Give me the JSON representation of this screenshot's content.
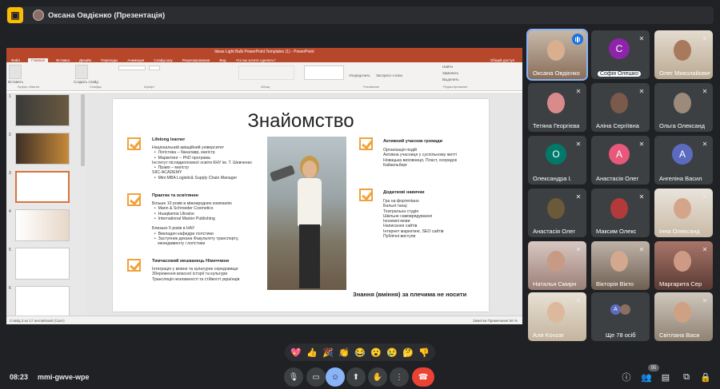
{
  "presenter": {
    "name": "Оксана Овдієнко (Презентація)"
  },
  "ppt": {
    "window_title": "Ideas Light Bulb PowerPoint Templates (1) - PowerPoint",
    "tabs": [
      "Файл",
      "Главная",
      "Вставка",
      "Дизайн",
      "Переходы",
      "Анимация",
      "Слайд-шоу",
      "Рецензирование",
      "Вид",
      "Что вы хотите сделать?"
    ],
    "share": "Общий доступ",
    "ribbon_groups": [
      "Буфер обмена",
      "Слайды",
      "Шрифт",
      "Абзац",
      "Рисование",
      "Редактирование"
    ],
    "ribbon_buttons": {
      "paste": "Вставить",
      "new_slide": "Создать слайд",
      "arrange": "Упорядочить",
      "styles": "Экспресс-стили",
      "find": "Найти",
      "replace": "Заменить",
      "select": "Выделить"
    },
    "status_left": "Слайд 3 из 17     английский (США)",
    "status_right": "Заметки   Примечания        56 %"
  },
  "slide": {
    "title": "Знайомство",
    "sections": [
      {
        "heading": "Lifelong learner",
        "body": "Національний авіаційний університет\n  •  Логістика – бакалавр, магістр\n  •  Маркетинг – PhD програма\nІнститут післядипломної освіти КНУ ім. Т. Шевченко\n  •  Право – магістр\nSIIC-ACADEMY\n  •  Mini MBA Logistic& Supply Chain Manager"
      },
      {
        "heading": "Практик та освітянин",
        "body": "Більше 10 років в міжнародних компаніях\n  •  Mann & Schroeder Cosmetics\n  •  Huaqiiamia Ukraine\n  •  International Master Publishing\n\nБлизько 5 років в НАУ\n  •  Викладач кафедри логістики\n  •  Заступник декана Факультету транспорту,\n     менеджменту і логістики"
      },
      {
        "heading": "Тимчасовий мешканець Німеччини",
        "body": "Інтеграція у мовне та культурне середовище\nЗбереження власної історії та культури\nТрансляція незламності та стійкості українців"
      },
      {
        "heading": "Активний учасник громади",
        "body": "Організація подій\nАктивна учасниця у суспільному житті\nНовацька виховниця, Пласт, осередок\nКайзельберг"
      },
      {
        "heading": "Додаткові навички",
        "body": "Гра на фортепіано\nБальні танці\nТеатральна студія\nШкільне самоврядування\nІноземні мови\nНаписання сайтів\nІнтернет маркетинг, SEO сайтів\nПублічні виступи"
      }
    ],
    "tagline": "Знання (вміння) за плечима не носити"
  },
  "participants": [
    {
      "name": "Оксана Овдієнко",
      "type": "video",
      "speaking": true
    },
    {
      "name": "Софія Олешко",
      "type": "avatar",
      "letter": "С",
      "color": "#8e24aa"
    },
    {
      "name": "Олег Миколайович",
      "type": "video"
    },
    {
      "name": "Тетяна Георгієва",
      "type": "photo"
    },
    {
      "name": "Аліна Сергіївна",
      "type": "photo"
    },
    {
      "name": "Ольга Олександ",
      "type": "photo"
    },
    {
      "name": "Олександра І.",
      "type": "avatar",
      "letter": "О",
      "color": "#00796b"
    },
    {
      "name": "Анастасія Олег",
      "type": "avatar",
      "letter": "А",
      "color": "#e8587a"
    },
    {
      "name": "Ангеліна Васил",
      "type": "avatar",
      "letter": "А",
      "color": "#5c6bc0"
    },
    {
      "name": "Анастасія Олег",
      "type": "photo"
    },
    {
      "name": "Максим Олекс",
      "type": "photo"
    },
    {
      "name": "Інна Олександ",
      "type": "video"
    },
    {
      "name": "Наталья Смирн",
      "type": "video"
    },
    {
      "name": "Вікторія Вікто",
      "type": "video"
    },
    {
      "name": "Маргарита Сер",
      "type": "video"
    },
    {
      "name": "Аля Kovzar",
      "type": "video"
    },
    {
      "name": "Ще 78 осіб",
      "type": "more"
    },
    {
      "name": "Світлана Васи",
      "type": "video"
    }
  ],
  "reactions": [
    "💖",
    "👍",
    "🎉",
    "👏",
    "😂",
    "😮",
    "😢",
    "🤔",
    "👎"
  ],
  "meeting": {
    "time": "08:23",
    "code": "mmi-gwve-wpe",
    "participant_count": "95"
  }
}
